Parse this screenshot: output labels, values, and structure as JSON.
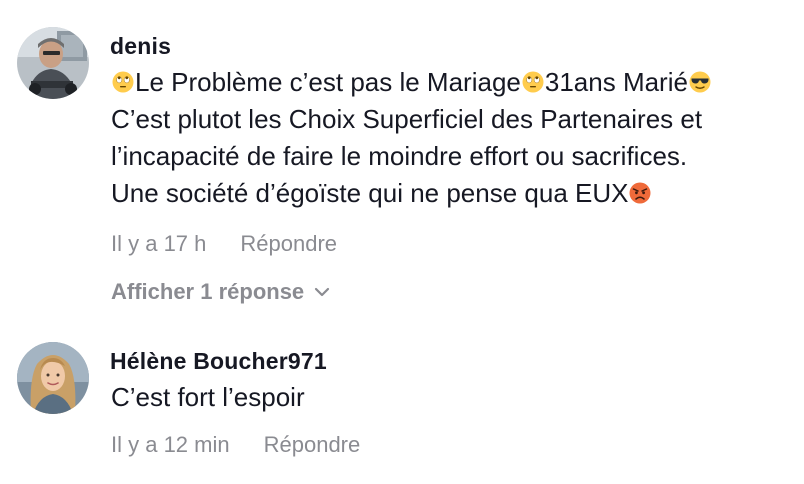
{
  "comments": [
    {
      "author": "denis",
      "lines": [
        {
          "parts": [
            "",
            "Le Problème c’est pas le Mariage",
            "31ans Marié",
            ""
          ]
        },
        {
          "text": "C’est plutot les Choix Superficiel des Partenaires et"
        },
        {
          "text": "l’incapacité de faire le moindre effort ou sacrifices."
        },
        {
          "text_before": "Une société d’égoïste qui ne pense qua EUX"
        }
      ],
      "emojis": [
        "rolling-eyes-emoji",
        "rolling-eyes-emoji",
        "sunglasses-emoji",
        "angry-face-emoji"
      ],
      "time": "Il y a 17 h",
      "reply_label": "Répondre",
      "show_replies_label": "Afficher 1 réponse"
    },
    {
      "author": "Hélène Boucher971",
      "text": "C’est fort l’espoir",
      "time": "Il y a 12 min",
      "reply_label": "Répondre"
    }
  ],
  "colors": {
    "text_primary": "#161823",
    "text_secondary": "#8a8b91",
    "background": "#ffffff"
  }
}
